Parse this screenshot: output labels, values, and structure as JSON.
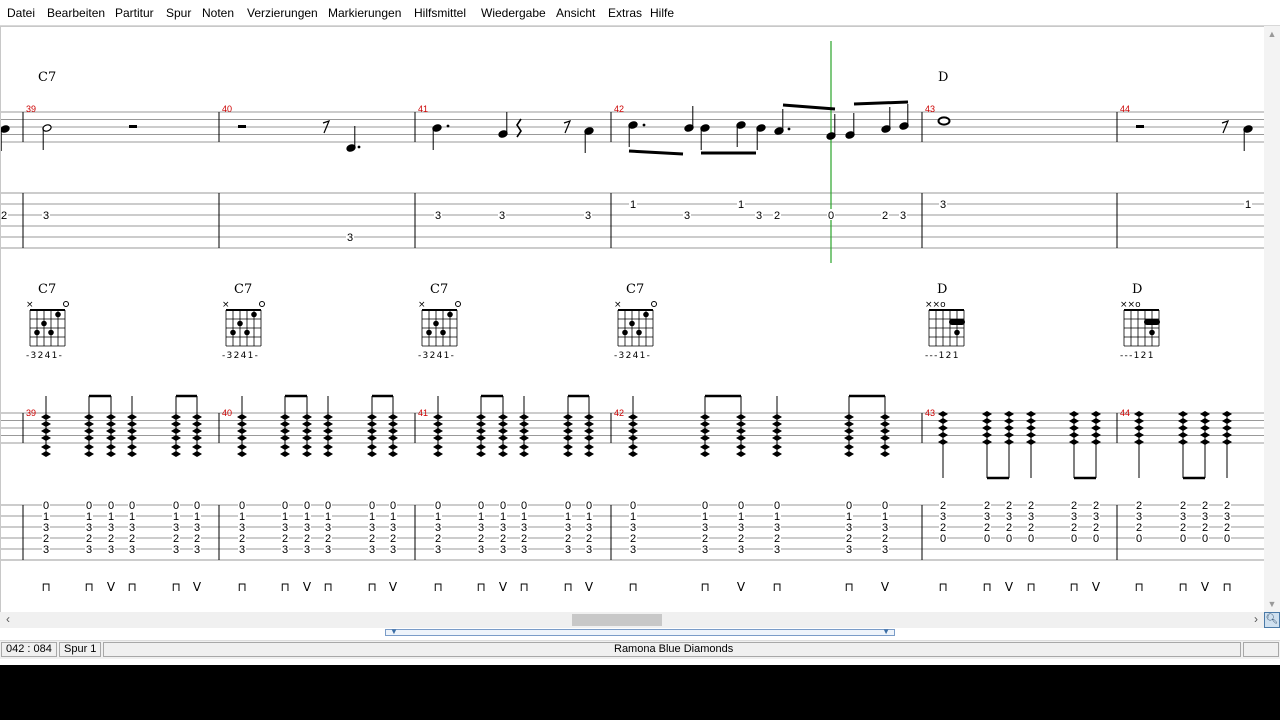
{
  "menu": [
    "Datei",
    "Bearbeiten",
    "Partitur",
    "Spur",
    "Noten",
    "Verzierungen",
    "Markierungen",
    "Hilfsmittel",
    "Wiedergabe",
    "Ansicht",
    "Extras",
    "Hilfe"
  ],
  "score": {
    "top_chords": [
      {
        "measure": 39,
        "name": "C7"
      },
      {
        "measure": 43,
        "name": "D"
      }
    ],
    "measures": [
      39,
      40,
      41,
      42,
      43,
      44
    ],
    "top_tab": {
      "prev": [
        "2"
      ],
      "m39": [
        "3"
      ],
      "m40": [
        "3"
      ],
      "m41": [
        "3",
        "3",
        "3"
      ],
      "m42": [
        "1",
        "3",
        "1",
        "3",
        "2",
        "0",
        "2",
        "3"
      ],
      "m43": [
        "3"
      ],
      "m44": [
        "1"
      ]
    },
    "chord_diagrams": [
      {
        "measure": 39,
        "name": "C7",
        "fingering": "-3241-"
      },
      {
        "measure": 40,
        "name": "C7",
        "fingering": "-3241-"
      },
      {
        "measure": 41,
        "name": "C7",
        "fingering": "-3241-"
      },
      {
        "measure": 42,
        "name": "C7",
        "fingering": "-3241-"
      },
      {
        "measure": 43,
        "name": "D",
        "fingering": "---121"
      },
      {
        "measure": 44,
        "name": "D",
        "fingering": "---121"
      }
    ],
    "bottom_tab": {
      "c7_column": [
        "0",
        "1",
        "3",
        "2",
        "3"
      ],
      "c7_column_alt": [
        "0",
        "1",
        "3",
        "2",
        "3"
      ],
      "d_column": [
        "2",
        "3",
        "2",
        "0"
      ]
    },
    "strokes": {
      "down": "⊓",
      "up": "V"
    }
  },
  "status": {
    "position": "042 : 084",
    "track": "Spur 1",
    "song": "Ramona   Blue Diamonds"
  },
  "colors": {
    "cursor": "#2aa32a",
    "measure_number": "#cc0000"
  }
}
